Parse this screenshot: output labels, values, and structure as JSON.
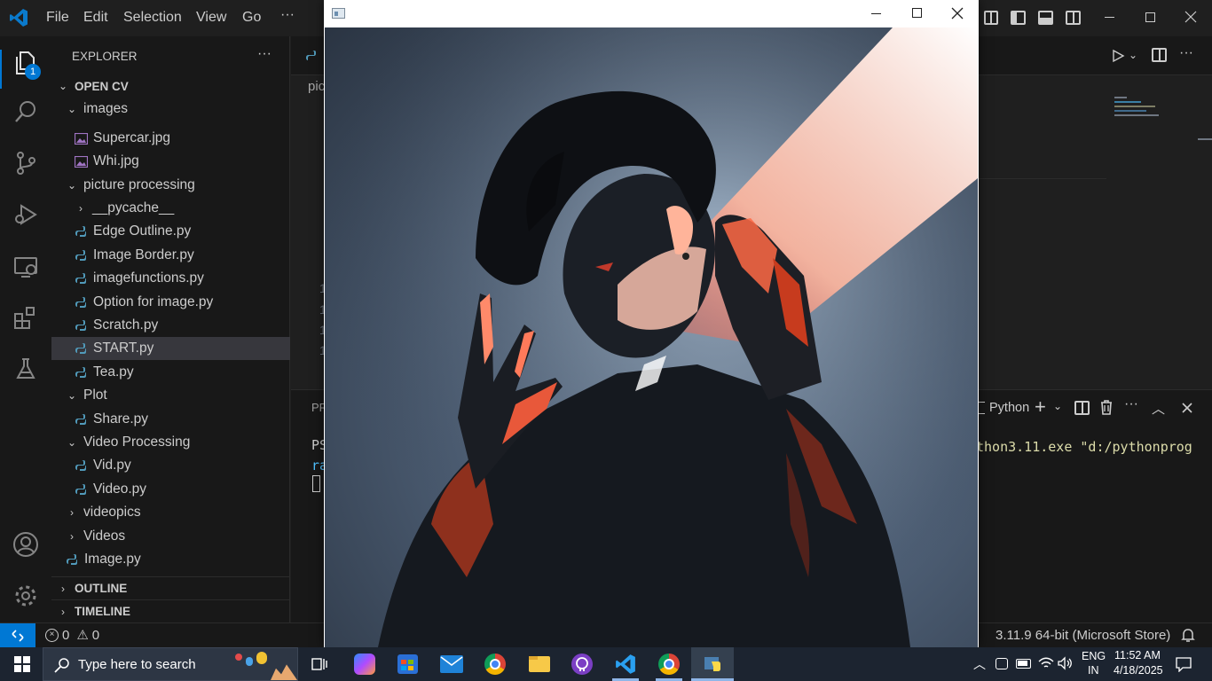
{
  "titlebar": {
    "menu": [
      "File",
      "Edit",
      "Selection",
      "View",
      "Go",
      "···"
    ]
  },
  "activity": {
    "explorer_badge": "1"
  },
  "sidebar": {
    "header": "EXPLORER",
    "header_more": "···",
    "root": "OPEN CV",
    "tree": [
      {
        "label": "images",
        "kind": "folder-open"
      },
      {
        "label": "Supercar.jpg",
        "kind": "image"
      },
      {
        "label": "Whi.jpg",
        "kind": "image"
      },
      {
        "label": "picture processing",
        "kind": "folder-open"
      },
      {
        "label": "__pycache__",
        "kind": "folder-closed"
      },
      {
        "label": "Edge Outline.py",
        "kind": "py"
      },
      {
        "label": "Image Border.py",
        "kind": "py"
      },
      {
        "label": "imagefunctions.py",
        "kind": "py"
      },
      {
        "label": "Option for image.py",
        "kind": "py"
      },
      {
        "label": "Scratch.py",
        "kind": "py"
      },
      {
        "label": "START.py",
        "kind": "py",
        "selected": true
      },
      {
        "label": "Tea.py",
        "kind": "py"
      },
      {
        "label": "Plot",
        "kind": "folder-open"
      },
      {
        "label": "Share.py",
        "kind": "py"
      },
      {
        "label": "Video Processing",
        "kind": "folder-open"
      },
      {
        "label": "Vid.py",
        "kind": "py"
      },
      {
        "label": "Video.py",
        "kind": "py"
      },
      {
        "label": "videopics",
        "kind": "folder-closed"
      },
      {
        "label": "Videos",
        "kind": "folder-closed"
      },
      {
        "label": "Image.py",
        "kind": "py"
      }
    ],
    "outline": "OUTLINE",
    "timeline": "TIMELINE"
  },
  "editor": {
    "breadcrumb_fragment": "pic",
    "line_fragments": [
      "1",
      "1",
      "1",
      "1"
    ],
    "panel_tab_fragment": "PR",
    "terminal_fragment_1": "PS",
    "terminal_fragment_2": "ra",
    "terminal_label": "Python",
    "terminal_command": "thon3.11.exe \"d:/pythonprog"
  },
  "statusbar": {
    "errors": "0",
    "warnings": "0",
    "interpreter": "3.11.9 64-bit (Microsoft Store)"
  },
  "taskbar": {
    "search_placeholder": "Type here to search",
    "lang_top": "ENG",
    "lang_bottom": "IN",
    "time": "11:52 AM",
    "date": "4/18/2025"
  },
  "colors": {
    "accent": "#0078d4",
    "python_blue": "#519aba",
    "python_yellow": "#f9d849",
    "terminal_yellow": "#dcdcaa",
    "terminal_blue": "#4fc1ff",
    "taskbar": "#1c2430"
  }
}
